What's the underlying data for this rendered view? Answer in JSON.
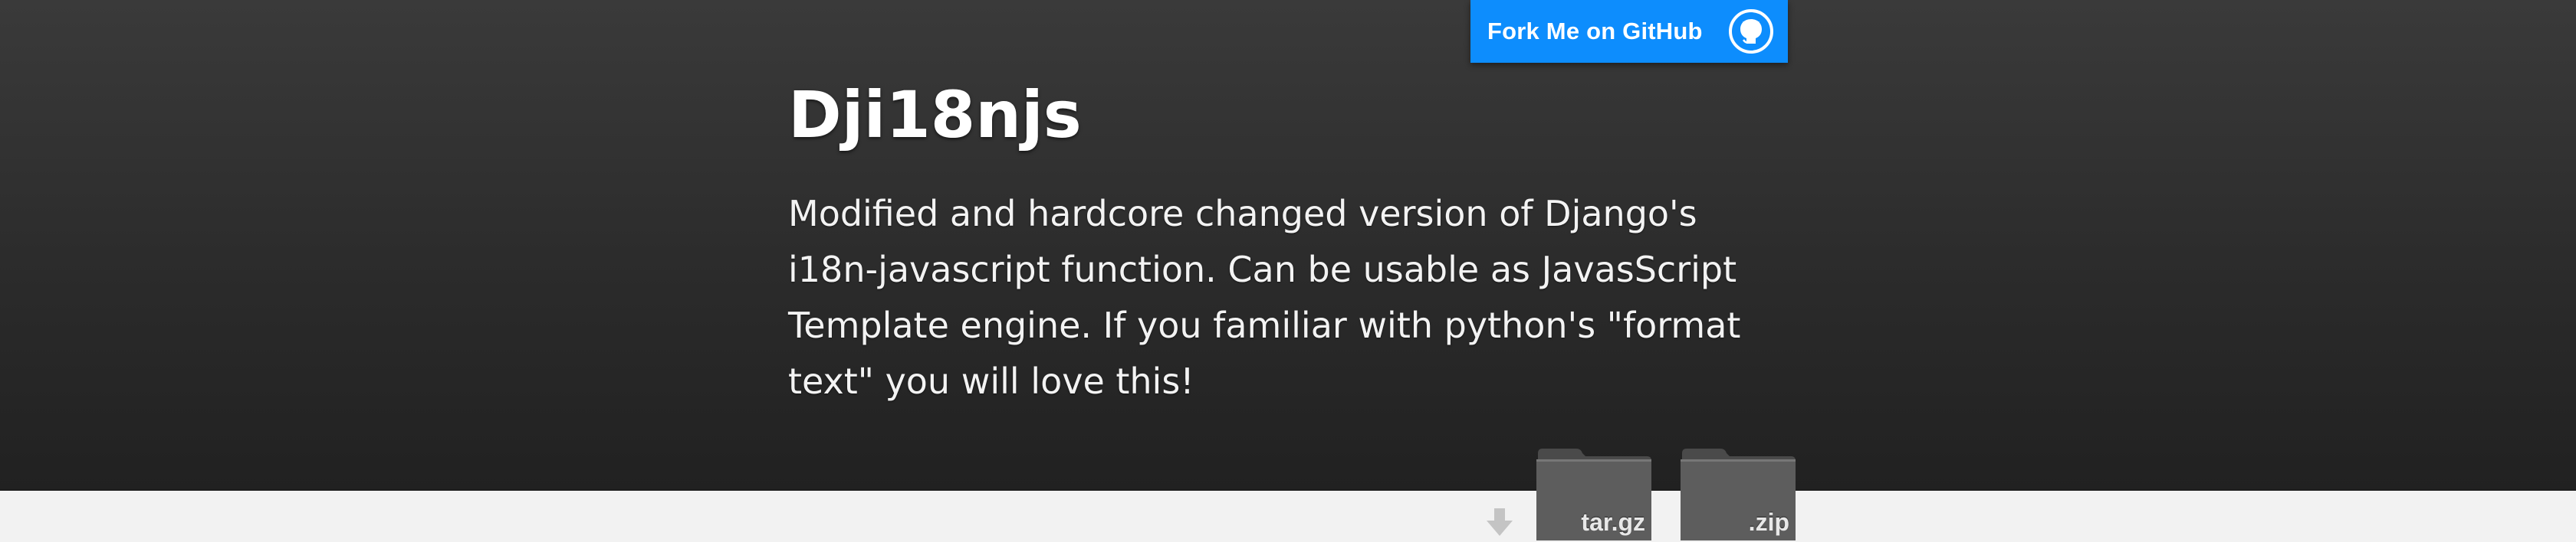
{
  "fork": {
    "label": "Fork Me on GitHub",
    "icon": "github-octocat-icon",
    "color": "#0d8dfd"
  },
  "header": {
    "title": "Dji18njs",
    "description": "Modified and hardcore changed version of Django's i18n-javascript function. Can be usable as JavasScript Template engine. If you familiar with python's \"format text\" you will love this!"
  },
  "downloads": {
    "icon": "download-arrow-icon",
    "items": [
      {
        "label": "tar.gz",
        "icon": "folder-icon"
      },
      {
        "label": ".zip",
        "icon": "folder-icon"
      }
    ]
  }
}
